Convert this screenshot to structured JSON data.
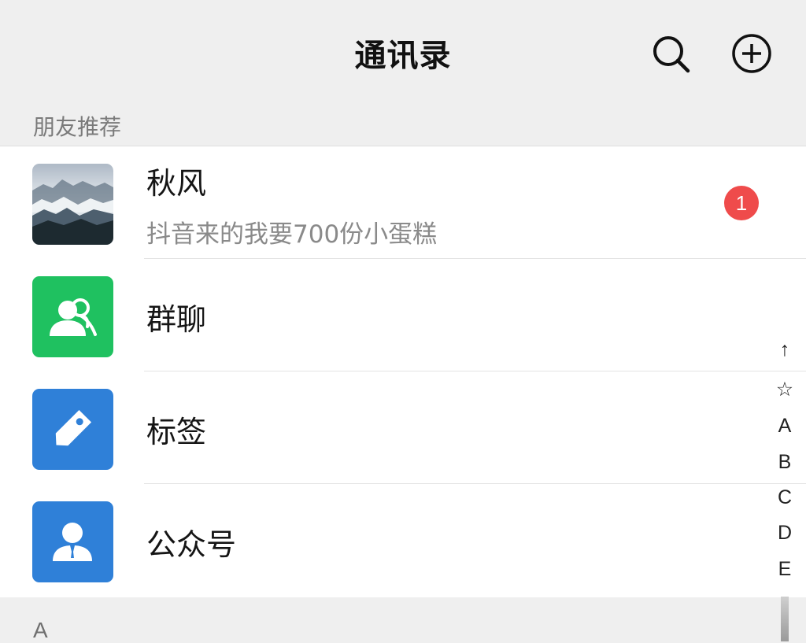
{
  "header": {
    "title": "通讯录",
    "search_icon": "search-icon",
    "add_icon": "plus-circle-icon"
  },
  "recommend": {
    "label": "朋友推荐",
    "name": "秋风",
    "message": "抖音来的我要700份小蛋糕",
    "badge": "1",
    "badge_color": "#ef4b4b"
  },
  "entries": [
    {
      "label": "群聊",
      "icon": "group-chat-icon",
      "color": "#1fc160"
    },
    {
      "label": "标签",
      "icon": "tag-icon",
      "color": "#2f80d8"
    },
    {
      "label": "公众号",
      "icon": "official-account-icon",
      "color": "#2f80d8"
    }
  ],
  "index": [
    "↑",
    "☆",
    "A",
    "B",
    "C",
    "D",
    "E"
  ],
  "group_header": "A"
}
